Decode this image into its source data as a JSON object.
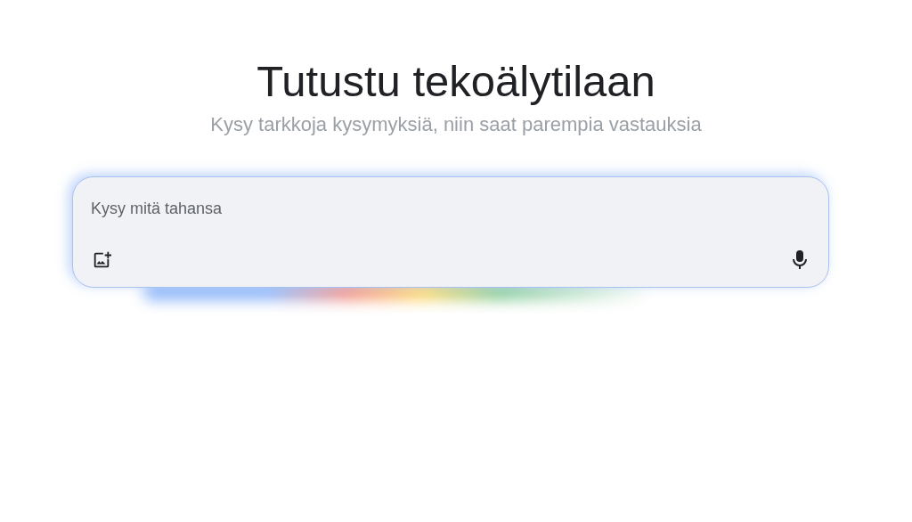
{
  "heading": "Tutustu tekoälytilaan",
  "subheading": "Kysy tarkkoja kysymyksiä, niin saat parempia vastauksia",
  "prompt": {
    "placeholder": "Kysy mitä tahansa"
  }
}
